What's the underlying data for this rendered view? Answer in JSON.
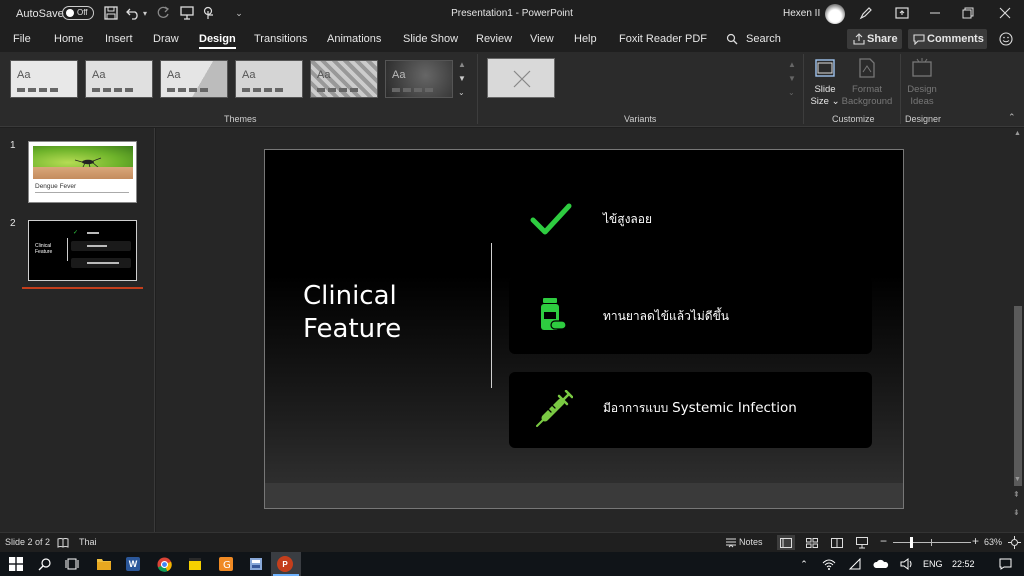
{
  "titlebar": {
    "autosave_label": "AutoSave",
    "autosave_state": "Off",
    "doc_title": "Presentation1  -  PowerPoint",
    "user_name": "Hexen II"
  },
  "tabs": [
    "File",
    "Home",
    "Insert",
    "Draw",
    "Design",
    "Transitions",
    "Animations",
    "Slide Show",
    "Review",
    "View",
    "Help",
    "Foxit Reader PDF"
  ],
  "active_tab": "Design",
  "search_label": "Search",
  "share_label": "Share",
  "comments_label": "Comments",
  "ribbon": {
    "themes_label": "Themes",
    "variants_label": "Variants",
    "customize_label": "Customize",
    "designer_label": "Designer",
    "slide_size_line1": "Slide",
    "slide_size_line2": "Size",
    "format_bg_line1": "Format",
    "format_bg_line2": "Background",
    "design_ideas_line1": "Design",
    "design_ideas_line2": "Ideas",
    "theme_sample": "Aa"
  },
  "thumbnails": [
    {
      "number": "1",
      "caption": "Dengue Fever"
    },
    {
      "number": "2",
      "caption": "Clinical Feature"
    }
  ],
  "slide": {
    "title_line1": "Clinical",
    "title_line2": "Feature",
    "item1": "ไข้สูงลอย",
    "item2": "ทานยาลดไข้แล้วไม่ดีขึ้น",
    "item3_prefix": "มีอาการแบบ ",
    "item3_bold": "Systemic Infection",
    "accent": "#2ecc40",
    "icon_green": "#7ac943"
  },
  "status": {
    "slide_counter": "Slide 2 of 2",
    "language": "Thai",
    "notes_label": "Notes",
    "zoom": "63%"
  },
  "taskbar": {
    "lang": "ENG",
    "time": "22:52"
  }
}
